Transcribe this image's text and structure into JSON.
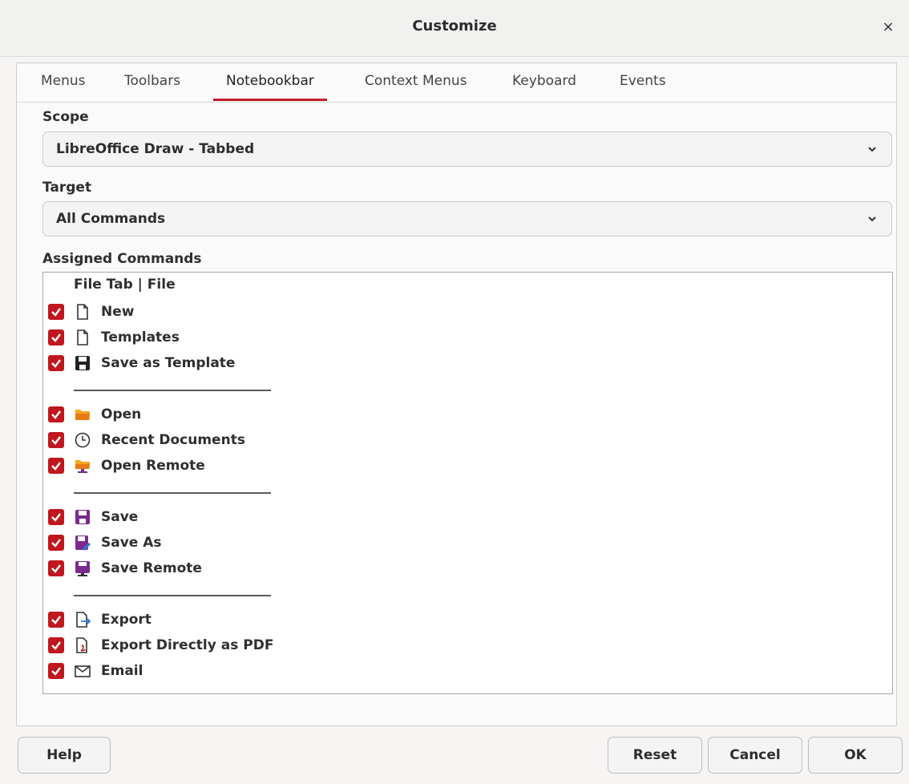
{
  "dialog": {
    "title": "Customize",
    "close_glyph": "×"
  },
  "tabs": [
    {
      "label": "Menus",
      "active": false
    },
    {
      "label": "Toolbars",
      "active": false
    },
    {
      "label": "Notebookbar",
      "active": true
    },
    {
      "label": "Context Menus",
      "active": false
    },
    {
      "label": "Keyboard",
      "active": false
    },
    {
      "label": "Events",
      "active": false
    }
  ],
  "scope": {
    "label": "Scope",
    "value": "LibreOffice Draw - Tabbed"
  },
  "target": {
    "label": "Target",
    "value": "All Commands"
  },
  "assigned": {
    "label": "Assigned Commands",
    "header": "File Tab | File",
    "items": [
      {
        "label": "New",
        "checked": true,
        "icon": "document-icon"
      },
      {
        "label": "Templates",
        "checked": true,
        "icon": "document-icon"
      },
      {
        "label": "Save as Template",
        "checked": true,
        "icon": "floppy-icon"
      },
      {
        "separator": true
      },
      {
        "label": "Open",
        "checked": true,
        "icon": "folder-icon"
      },
      {
        "label": "Recent Documents",
        "checked": true,
        "icon": "clock-icon"
      },
      {
        "label": "Open Remote",
        "checked": true,
        "icon": "folder-remote-icon"
      },
      {
        "separator": true
      },
      {
        "label": "Save",
        "checked": true,
        "icon": "save-icon"
      },
      {
        "label": "Save As",
        "checked": true,
        "icon": "save-as-icon"
      },
      {
        "label": "Save Remote",
        "checked": true,
        "icon": "save-remote-icon"
      },
      {
        "separator": true
      },
      {
        "label": "Export",
        "checked": true,
        "icon": "export-icon"
      },
      {
        "label": "Export Directly as PDF",
        "checked": true,
        "icon": "pdf-icon"
      },
      {
        "label": "Email",
        "checked": true,
        "icon": "envelope-icon"
      }
    ]
  },
  "buttons": {
    "help": "Help",
    "reset": "Reset",
    "cancel": "Cancel",
    "ok": "OK"
  },
  "colors": {
    "accent": "#c01c28",
    "checkbox": "#c0161d",
    "purple": "#7b2a8d",
    "orange": "#e87a16"
  }
}
